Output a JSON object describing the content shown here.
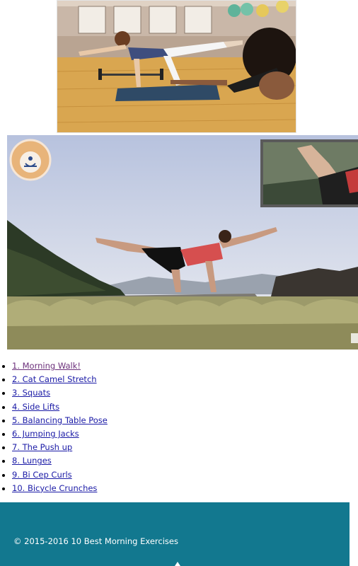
{
  "exercises": [
    {
      "label": "1. Morning Walk!",
      "visited": true
    },
    {
      "label": "2. Cat Camel Stretch",
      "visited": false
    },
    {
      "label": "3. Squats",
      "visited": false
    },
    {
      "label": "4. Side Lifts",
      "visited": false
    },
    {
      "label": "5. Balancing Table Pose",
      "visited": false
    },
    {
      "label": "6. Jumping Jacks",
      "visited": false
    },
    {
      "label": "7. The Push up",
      "visited": false
    },
    {
      "label": "8. Lunges",
      "visited": false
    },
    {
      "label": "9. Bi Cep Curls",
      "visited": false
    },
    {
      "label": "10. Bicycle Crunches",
      "visited": false
    }
  ],
  "footer": {
    "copyright": "© 2015-2016 10 Best Morning Exercises"
  },
  "colors": {
    "link": "#1a1aa6",
    "visited_link": "#6b2f7a",
    "footer_bg": "#12788f"
  }
}
